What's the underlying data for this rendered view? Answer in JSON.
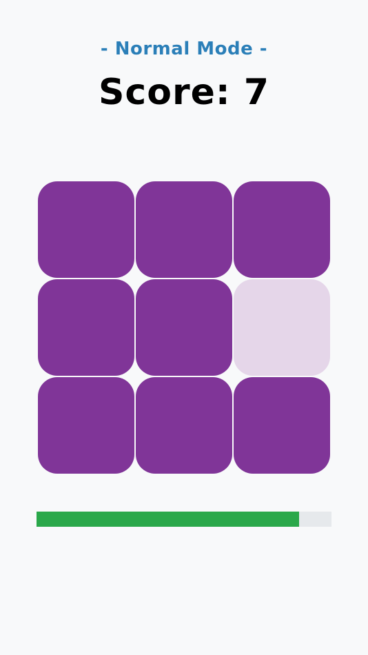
{
  "header": {
    "mode_label": "- Normal Mode -",
    "score_label": "Score:",
    "score_value": "7"
  },
  "grid": {
    "rows": 3,
    "cols": 3,
    "tiles": [
      {
        "state": "dark"
      },
      {
        "state": "dark"
      },
      {
        "state": "dark"
      },
      {
        "state": "dark"
      },
      {
        "state": "dark"
      },
      {
        "state": "light"
      },
      {
        "state": "dark"
      },
      {
        "state": "dark"
      },
      {
        "state": "dark"
      }
    ],
    "dark_color": "#803598",
    "light_color": "#e5d6e9"
  },
  "timer": {
    "progress": 0.89,
    "fill_color": "#2aa84a",
    "track_color": "#e6e9ec"
  }
}
